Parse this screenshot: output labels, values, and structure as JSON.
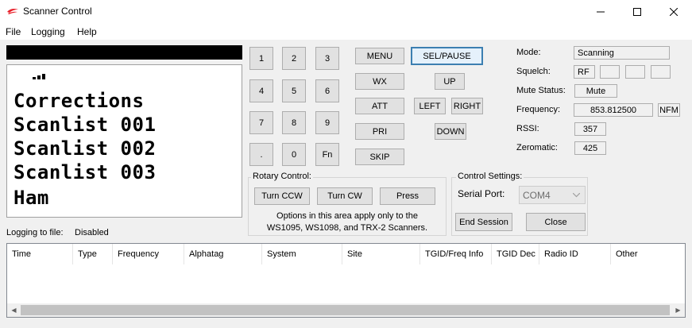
{
  "window": {
    "title": "Scanner Control"
  },
  "menu": [
    "File",
    "Logging",
    "Help"
  ],
  "lcd": {
    "lines": [
      "Corrections",
      "Scanlist 001",
      "Scanlist 002",
      "Scanlist 003",
      "Ham"
    ],
    "signal_bars": 3
  },
  "keypad": [
    "1",
    "2",
    "3",
    "4",
    "5",
    "6",
    "7",
    "8",
    "9",
    ".",
    "0",
    "Fn"
  ],
  "controls": {
    "menu": "MENU",
    "sel_pause": "SEL/PAUSE",
    "wx": "WX",
    "up": "UP",
    "att": "ATT",
    "left": "LEFT",
    "right": "RIGHT",
    "pri": "PRI",
    "down": "DOWN",
    "skip": "SKIP"
  },
  "rotary": {
    "title": "Rotary Control:",
    "turn_ccw": "Turn CCW",
    "turn_cw": "Turn CW",
    "press": "Press",
    "note_line1": "Options in this area apply only to the",
    "note_line2": "WS1095, WS1098, and TRX-2 Scanners."
  },
  "control_settings": {
    "title": "Control Settings:",
    "serial_port_label": "Serial Port:",
    "serial_port_value": "COM4",
    "end_session": "End Session",
    "close": "Close"
  },
  "status": {
    "mode_label": "Mode:",
    "mode_value": "Scanning",
    "squelch_label": "Squelch:",
    "squelch_value": "RF",
    "mute_label": "Mute Status:",
    "mute_value": "Mute",
    "frequency_label": "Frequency:",
    "frequency_value": "853.812500",
    "modulation": "NFM",
    "rssi_label": "RSSI:",
    "rssi_value": "357",
    "zeromatic_label": "Zeromatic:",
    "zeromatic_value": "425"
  },
  "logging": {
    "label": "Logging to file:",
    "value": "Disabled"
  },
  "log_table": {
    "columns": [
      "Time",
      "Type",
      "Frequency",
      "Alphatag",
      "System",
      "Site",
      "TGID/Freq Info",
      "TGID Dec",
      "Radio ID",
      "Other"
    ],
    "rows": []
  },
  "colors": {
    "accent": "#3c7fb1",
    "app_icon": "#e8202a"
  }
}
